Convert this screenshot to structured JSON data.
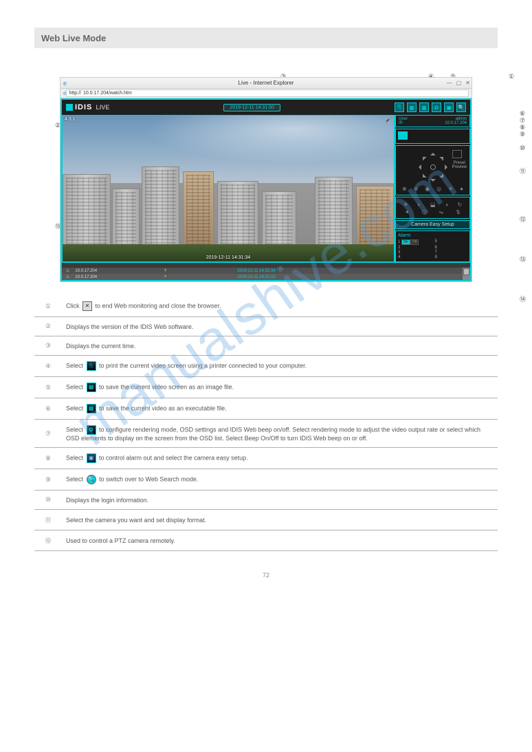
{
  "section": {
    "title": "Web Live Mode",
    "subtitle": ""
  },
  "watermark": "manualshive.com",
  "browser": {
    "title": "Live - Internet Explorer",
    "url_prefix": "http://",
    "url": "10.0.17.204/watch.htm"
  },
  "app": {
    "logo": "IDIS",
    "logo_sub": "LIVE",
    "timestamp": "2019-12-11 14:31:50",
    "info": {
      "user_label": "User:",
      "user": "admin",
      "ip_label": "IP:",
      "ip": "10.0.17.204"
    },
    "ptz": {
      "preset": "Preset",
      "preview": "Preview"
    },
    "easy_setup": "Camera Easy Setup",
    "alarm": {
      "title": "Alarm",
      "items": [
        "1",
        "2",
        "3",
        "4",
        "5",
        "6",
        "7",
        "8"
      ],
      "on": "On",
      "off": "Off"
    },
    "camera_label": "4.3.1",
    "video_ts": "2019-12-11 14:31:34"
  },
  "events": [
    {
      "ip": "10.0.17.204",
      "time": "2019-12-11 14:31:34"
    },
    {
      "ip": "10.0.17.204",
      "time": "2019-12-11 14:31:22"
    }
  ],
  "callouts": [
    "①",
    "②",
    "③",
    "④",
    "⑤",
    "⑥",
    "⑦",
    "⑧",
    "⑨",
    "⑩",
    "⑪",
    "⑫",
    "⑬",
    "⑭",
    "⑮"
  ],
  "table": {
    "rows": [
      {
        "n": "①",
        "text_a": "Click ",
        "icon": "close",
        "text_b": " to end Web monitoring and close the browser."
      },
      {
        "n": "②",
        "text_a": "Displays the version of the IDIS Web software.",
        "icon": "",
        "text_b": ""
      },
      {
        "n": "③",
        "text_a": "Displays the current time.",
        "icon": "",
        "text_b": ""
      },
      {
        "n": "④",
        "text_a": "Select ",
        "icon": "print",
        "text_b": " to print the current video screen using a printer connected to your computer."
      },
      {
        "n": "⑤",
        "text_a": "Select ",
        "icon": "save",
        "text_b": " to save the current video screen as an image file."
      },
      {
        "n": "⑥",
        "text_a": "Select ",
        "icon": "save",
        "text_b": " to save the current video as an executable file."
      },
      {
        "n": "⑦",
        "text_a": "Select ",
        "icon": "setup",
        "text_b": " to configure rendering mode, OSD settings and IDIS Web beep on/off. Select rendering mode to adjust the video output rate or select which OSD elements to display on the screen from the OSD list. Select Beep On/Off to turn IDIS Web beep on or off."
      },
      {
        "n": "⑧",
        "text_a": "Select ",
        "icon": "event",
        "text_b": " to control alarm out and select the camera easy setup."
      },
      {
        "n": "⑨",
        "text_a": "Select ",
        "icon": "search",
        "text_b": " to switch over to Web Search mode."
      },
      {
        "n": "⑩",
        "text_a": "Displays the login information.",
        "icon": "",
        "text_b": ""
      },
      {
        "n": "⑪",
        "text_a": "Select the camera you want and set display format.",
        "icon": "",
        "text_b": ""
      },
      {
        "n": "⑫",
        "text_a": "Used to control a PTZ camera remotely.",
        "icon": "",
        "text_b": ""
      }
    ]
  },
  "page_number": "72"
}
